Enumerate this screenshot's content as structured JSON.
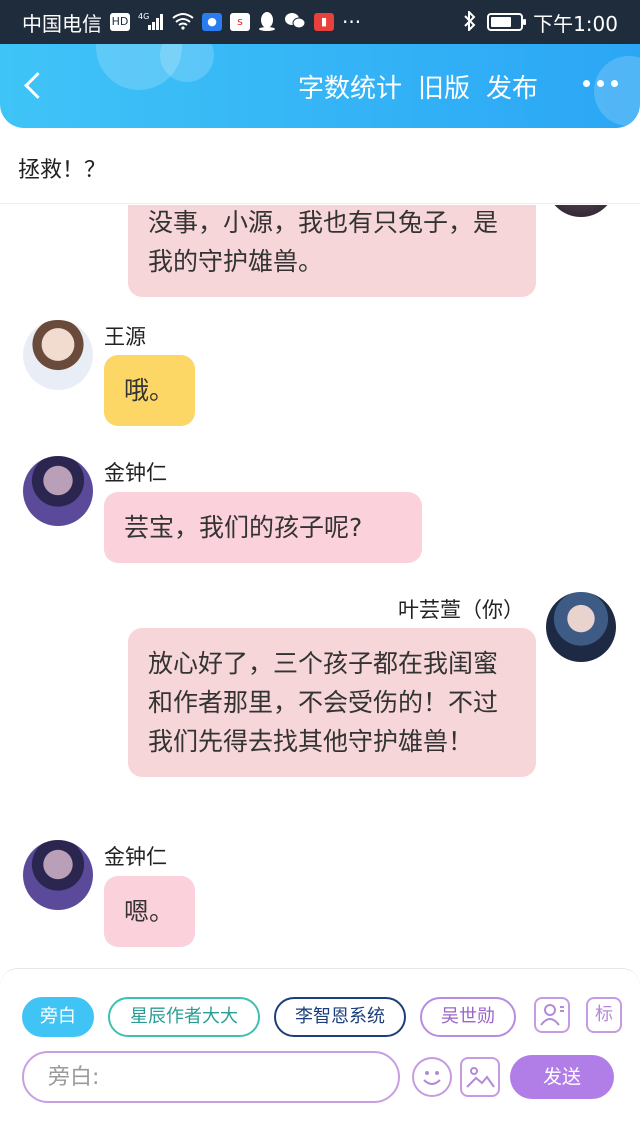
{
  "status_bar": {
    "carrier": "中国电信",
    "network_badge": "HD",
    "signal_label": "4G",
    "time": "下午1:00"
  },
  "header": {
    "word_count_label": "字数统计",
    "old_version_label": "旧版",
    "publish_label": "发布"
  },
  "title": "拯救！？",
  "messages": [
    {
      "side": "right",
      "sender": "",
      "text": "没事，小源，我也有只兔子，是我的守护雄兽。"
    },
    {
      "side": "left",
      "sender": "王源",
      "text": "哦。"
    },
    {
      "side": "left",
      "sender": "金钟仁",
      "text": "芸宝，我们的孩子呢?"
    },
    {
      "side": "right",
      "sender": "叶芸萱（你）",
      "text": "放心好了，三个孩子都在我闺蜜和作者那里，不会受伤的！不过我们先得去找其他守护雄兽！"
    },
    {
      "side": "left",
      "sender": "金钟仁",
      "text": "嗯。"
    }
  ],
  "roles": {
    "narration": "旁白",
    "role1": "星辰作者大大",
    "role2": "李智恩系统",
    "role3": "吴世勋",
    "tag_label": "标"
  },
  "input": {
    "placeholder": "旁白:",
    "send_label": "发送"
  },
  "colors": {
    "header_start": "#3fc4f7",
    "header_end": "#2ba6f5",
    "accent_purple": "#b07ee6"
  }
}
